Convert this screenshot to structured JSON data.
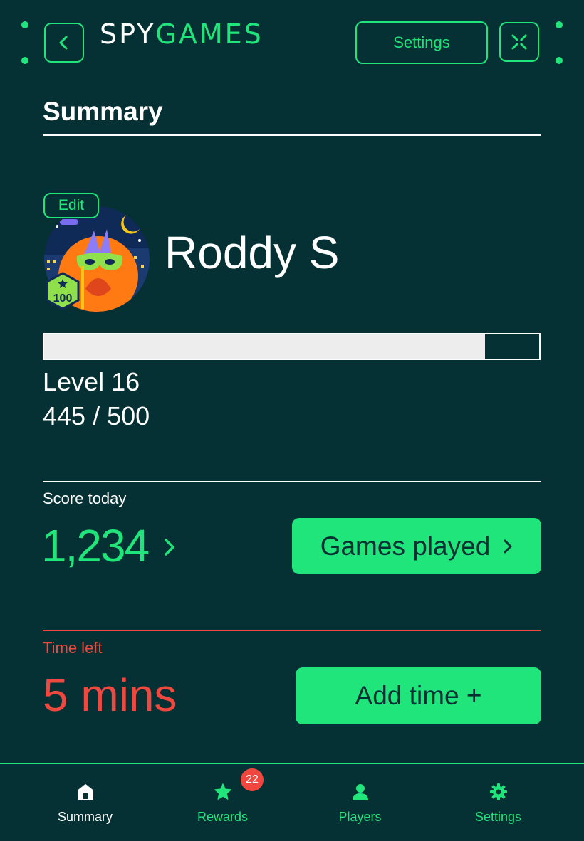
{
  "app": {
    "logo_text": "SPYGAMES"
  },
  "header": {
    "settings_label": "Settings"
  },
  "page": {
    "title": "Summary"
  },
  "profile": {
    "edit_label": "Edit",
    "name": "Roddy S",
    "badge_value": "100",
    "level_label": "Level 16",
    "xp_text": "445 / 500",
    "xp_progress": 0.89
  },
  "score": {
    "label": "Score today",
    "value": "1,234",
    "games_played_label": "Games played"
  },
  "time": {
    "label": "Time left",
    "value": "5 mins",
    "add_time_label": "Add time +"
  },
  "nav": {
    "items": [
      {
        "label": "Summary",
        "icon": "home-icon",
        "active": true
      },
      {
        "label": "Rewards",
        "icon": "star-icon",
        "badge": "22"
      },
      {
        "label": "Players",
        "icon": "person-icon"
      },
      {
        "label": "Settings",
        "icon": "gear-icon"
      }
    ]
  },
  "colors": {
    "background": "#063134",
    "accent": "#20e57a",
    "danger": "#f0483e",
    "text": "#ffffff"
  }
}
